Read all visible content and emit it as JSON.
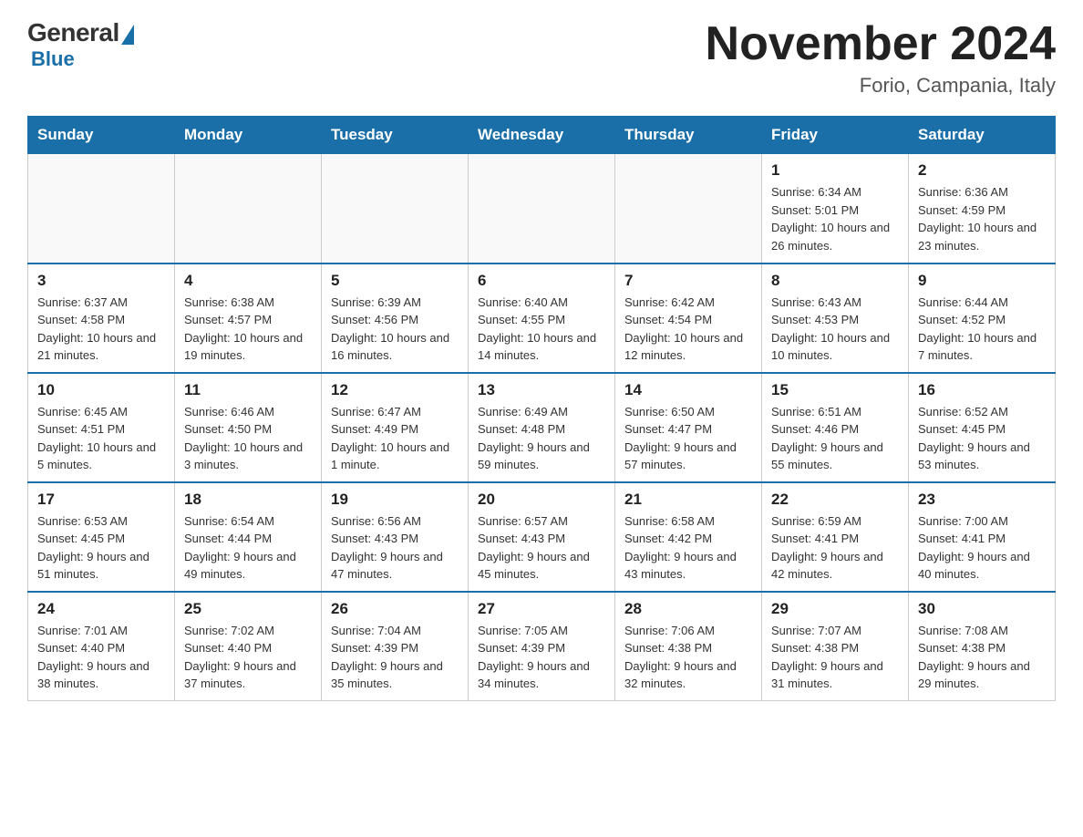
{
  "header": {
    "logo": {
      "general": "General",
      "blue": "Blue"
    },
    "month_title": "November 2024",
    "subtitle": "Forio, Campania, Italy"
  },
  "days_of_week": [
    "Sunday",
    "Monday",
    "Tuesday",
    "Wednesday",
    "Thursday",
    "Friday",
    "Saturday"
  ],
  "weeks": [
    [
      {
        "day": "",
        "info": ""
      },
      {
        "day": "",
        "info": ""
      },
      {
        "day": "",
        "info": ""
      },
      {
        "day": "",
        "info": ""
      },
      {
        "day": "",
        "info": ""
      },
      {
        "day": "1",
        "info": "Sunrise: 6:34 AM\nSunset: 5:01 PM\nDaylight: 10 hours and 26 minutes."
      },
      {
        "day": "2",
        "info": "Sunrise: 6:36 AM\nSunset: 4:59 PM\nDaylight: 10 hours and 23 minutes."
      }
    ],
    [
      {
        "day": "3",
        "info": "Sunrise: 6:37 AM\nSunset: 4:58 PM\nDaylight: 10 hours and 21 minutes."
      },
      {
        "day": "4",
        "info": "Sunrise: 6:38 AM\nSunset: 4:57 PM\nDaylight: 10 hours and 19 minutes."
      },
      {
        "day": "5",
        "info": "Sunrise: 6:39 AM\nSunset: 4:56 PM\nDaylight: 10 hours and 16 minutes."
      },
      {
        "day": "6",
        "info": "Sunrise: 6:40 AM\nSunset: 4:55 PM\nDaylight: 10 hours and 14 minutes."
      },
      {
        "day": "7",
        "info": "Sunrise: 6:42 AM\nSunset: 4:54 PM\nDaylight: 10 hours and 12 minutes."
      },
      {
        "day": "8",
        "info": "Sunrise: 6:43 AM\nSunset: 4:53 PM\nDaylight: 10 hours and 10 minutes."
      },
      {
        "day": "9",
        "info": "Sunrise: 6:44 AM\nSunset: 4:52 PM\nDaylight: 10 hours and 7 minutes."
      }
    ],
    [
      {
        "day": "10",
        "info": "Sunrise: 6:45 AM\nSunset: 4:51 PM\nDaylight: 10 hours and 5 minutes."
      },
      {
        "day": "11",
        "info": "Sunrise: 6:46 AM\nSunset: 4:50 PM\nDaylight: 10 hours and 3 minutes."
      },
      {
        "day": "12",
        "info": "Sunrise: 6:47 AM\nSunset: 4:49 PM\nDaylight: 10 hours and 1 minute."
      },
      {
        "day": "13",
        "info": "Sunrise: 6:49 AM\nSunset: 4:48 PM\nDaylight: 9 hours and 59 minutes."
      },
      {
        "day": "14",
        "info": "Sunrise: 6:50 AM\nSunset: 4:47 PM\nDaylight: 9 hours and 57 minutes."
      },
      {
        "day": "15",
        "info": "Sunrise: 6:51 AM\nSunset: 4:46 PM\nDaylight: 9 hours and 55 minutes."
      },
      {
        "day": "16",
        "info": "Sunrise: 6:52 AM\nSunset: 4:45 PM\nDaylight: 9 hours and 53 minutes."
      }
    ],
    [
      {
        "day": "17",
        "info": "Sunrise: 6:53 AM\nSunset: 4:45 PM\nDaylight: 9 hours and 51 minutes."
      },
      {
        "day": "18",
        "info": "Sunrise: 6:54 AM\nSunset: 4:44 PM\nDaylight: 9 hours and 49 minutes."
      },
      {
        "day": "19",
        "info": "Sunrise: 6:56 AM\nSunset: 4:43 PM\nDaylight: 9 hours and 47 minutes."
      },
      {
        "day": "20",
        "info": "Sunrise: 6:57 AM\nSunset: 4:43 PM\nDaylight: 9 hours and 45 minutes."
      },
      {
        "day": "21",
        "info": "Sunrise: 6:58 AM\nSunset: 4:42 PM\nDaylight: 9 hours and 43 minutes."
      },
      {
        "day": "22",
        "info": "Sunrise: 6:59 AM\nSunset: 4:41 PM\nDaylight: 9 hours and 42 minutes."
      },
      {
        "day": "23",
        "info": "Sunrise: 7:00 AM\nSunset: 4:41 PM\nDaylight: 9 hours and 40 minutes."
      }
    ],
    [
      {
        "day": "24",
        "info": "Sunrise: 7:01 AM\nSunset: 4:40 PM\nDaylight: 9 hours and 38 minutes."
      },
      {
        "day": "25",
        "info": "Sunrise: 7:02 AM\nSunset: 4:40 PM\nDaylight: 9 hours and 37 minutes."
      },
      {
        "day": "26",
        "info": "Sunrise: 7:04 AM\nSunset: 4:39 PM\nDaylight: 9 hours and 35 minutes."
      },
      {
        "day": "27",
        "info": "Sunrise: 7:05 AM\nSunset: 4:39 PM\nDaylight: 9 hours and 34 minutes."
      },
      {
        "day": "28",
        "info": "Sunrise: 7:06 AM\nSunset: 4:38 PM\nDaylight: 9 hours and 32 minutes."
      },
      {
        "day": "29",
        "info": "Sunrise: 7:07 AM\nSunset: 4:38 PM\nDaylight: 9 hours and 31 minutes."
      },
      {
        "day": "30",
        "info": "Sunrise: 7:08 AM\nSunset: 4:38 PM\nDaylight: 9 hours and 29 minutes."
      }
    ]
  ]
}
